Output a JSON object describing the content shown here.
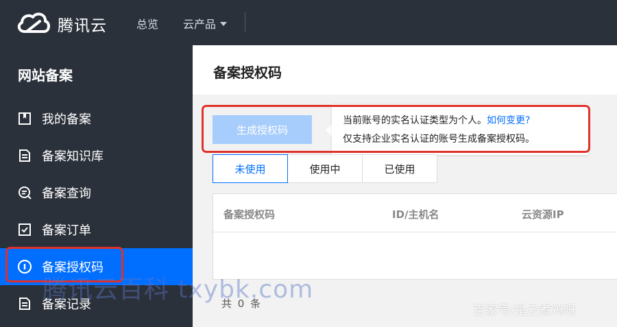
{
  "header": {
    "brand": "腾讯云",
    "nav": {
      "overview": "总览",
      "products": "云产品"
    }
  },
  "sidebar": {
    "title": "网站备案",
    "items": [
      {
        "label": "我的备案",
        "icon": "bookmark-icon"
      },
      {
        "label": "备案知识库",
        "icon": "document-icon"
      },
      {
        "label": "备案查询",
        "icon": "search-icon"
      },
      {
        "label": "备案订单",
        "icon": "checkbox-icon"
      },
      {
        "label": "备案授权码",
        "icon": "info-circle-icon",
        "active": true
      },
      {
        "label": "备案记录",
        "icon": "list-icon"
      }
    ]
  },
  "main": {
    "title": "备案授权码",
    "generate_button": "生成授权码",
    "tooltip": {
      "line1": "当前账号的实名认证类型为个人。",
      "link": "如何变更?",
      "line2": "仅支持企业实名认证的账号生成备案授权码。"
    },
    "tabs": [
      {
        "label": "未使用",
        "active": true
      },
      {
        "label": "使用中"
      },
      {
        "label": "已使用"
      }
    ],
    "table": {
      "columns": [
        "备案授权码",
        "ID/主机名",
        "云资源IP"
      ]
    },
    "total": "共 0 条"
  },
  "watermarks": {
    "primary": "腾讯云百科 txybk.com",
    "secondary": "百家号/是云煮鸡呀"
  },
  "colors": {
    "accent": "#006eff",
    "nav_bg": "#2b313b",
    "highlight": "#e0302a",
    "disabled_button": "#a6cdfb"
  }
}
